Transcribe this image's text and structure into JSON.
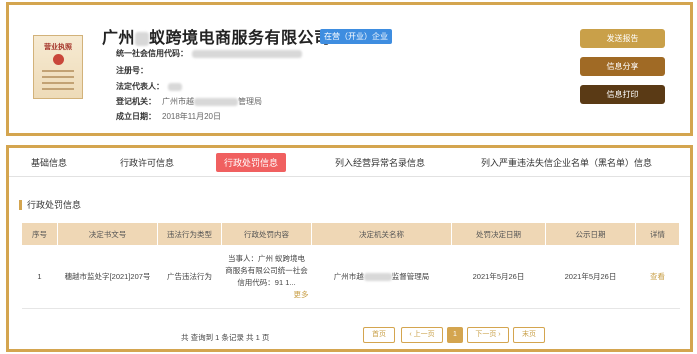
{
  "company": {
    "name_prefix": "广州",
    "name_suffix": "蚁跨境电商服务有限公司",
    "status": "在营（开业）企业",
    "credit_code_label": "统一社会信用代码：",
    "reg_no_label": "注册号：",
    "legal_rep_label": "法定代表人：",
    "authority_label": "登记机关：",
    "authority_value_prefix": "广州市越",
    "authority_value_suffix": "管理局",
    "date_label": "成立日期：",
    "date_value": "2018年11月20日"
  },
  "license": {
    "title": "营业执照"
  },
  "actions": {
    "report": "发送报告",
    "share": "信息分享",
    "print": "信息打印"
  },
  "tabs": [
    {
      "label": "基础信息"
    },
    {
      "label": "行政许可信息"
    },
    {
      "label": "行政处罚信息"
    },
    {
      "label": "列入经营异常名录信息"
    },
    {
      "label": "列入严重违法失信企业名单（黑名单）信息"
    }
  ],
  "section": {
    "title": "行政处罚信息"
  },
  "table": {
    "headers": [
      "序号",
      "决定书文号",
      "违法行为类型",
      "行政处罚内容",
      "决定机关名称",
      "处罚决定日期",
      "公示日期",
      "详情"
    ],
    "rows": [
      {
        "index": "1",
        "doc_no": "穗越市监处字[2021]207号",
        "type": "广告违法行为",
        "content": "当事人：广州 蚁跨境电商服务有限公司统一社会信用代码：91 1...",
        "more": "更多",
        "authority_prefix": "广州市越",
        "authority_suffix": "监督管理局",
        "decision_date": "2021年5月26日",
        "publish_date": "2021年5月26日",
        "detail": "查看"
      }
    ]
  },
  "pagination": {
    "summary": "共 查询到 1 条记录 共 1 页",
    "first": "首页",
    "prev": "‹ 上一页",
    "current": "1",
    "next": "下一页 ›",
    "last": "末页"
  },
  "colors": {
    "border": "#d4a54f",
    "status_badge": "#3e8de0",
    "active_tab": "#f06060",
    "table_header": "#efd7b5"
  }
}
